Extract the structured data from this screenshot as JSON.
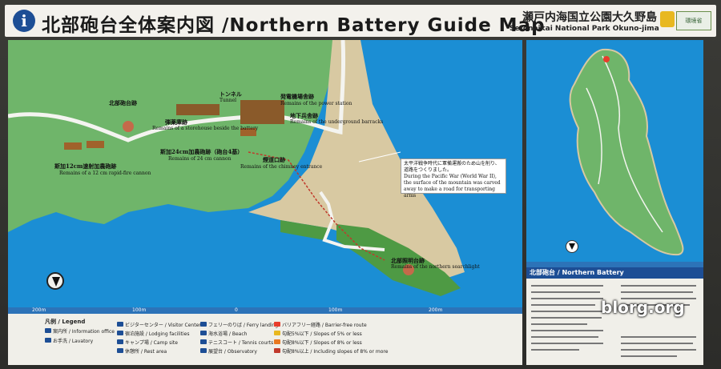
{
  "header": {
    "info_glyph": "i",
    "title": "北部砲台全体案内図 /Northern Battery Guide Map",
    "park_jp": "瀬戸内海国立公園大久野島",
    "park_en": "Setonaikai National Park Okuno-jima",
    "logo_text": "環境省"
  },
  "main_map": {
    "labels": {
      "tunnel": "トンネル",
      "tunnel_en": "Tunnel",
      "generator": "発電機場舎跡",
      "generator_en": "Remains of the power station",
      "north_battery": "北部砲台跡",
      "barracks": "地下兵舎跡",
      "barracks_en": "Remains of the underground barracks",
      "storehouse": "弾薬庫跡",
      "storehouse_en": "Remains of a storehouse beside the battery",
      "cannon": "斯加24cm加農砲跡（砲台4基）",
      "cannon_en": "Remains of 24 cm cannon",
      "rapid": "斯加12cm速射加農砲跡",
      "rapid_en": "Remains of a 12 cm rapid-fire cannon",
      "chimney": "煙道口跡",
      "chimney_en": "Remains of the chimney entrance",
      "searchlight": "北部照明台跡",
      "searchlight_en": "Remains of the northern searchlight"
    },
    "note_jp": "太平洋戦争時代に軍備運搬のため山を削り、道路をつくりました。",
    "note_en": "During the Pacific War (World War II), the surface of the mountain was carved away to make a road for transporting arms",
    "scale": [
      "200m",
      "100m",
      "0",
      "100m",
      "200m"
    ]
  },
  "legend": {
    "title": "凡例 / Legend",
    "items": [
      {
        "label": "案内所 / Information office",
        "color": "#1d4e95"
      },
      {
        "label": "お手洗 / Lavatory",
        "color": "#1d4e95"
      },
      {
        "label": "ビジターセンター / Visitor Center",
        "color": "#1d4e95"
      },
      {
        "label": "宿泊施設 / Lodging facilities",
        "color": "#1d4e95"
      },
      {
        "label": "キャンプ場 / Camp site",
        "color": "#1d4e95"
      },
      {
        "label": "休憩所 / Rest area",
        "color": "#1d4e95"
      },
      {
        "label": "フェリーのりば / Ferry landing",
        "color": "#1d4e95"
      },
      {
        "label": "海水浴場 / Beach",
        "color": "#1d4e95"
      },
      {
        "label": "テニスコート / Tennis courts",
        "color": "#1d4e95"
      },
      {
        "label": "展望台 / Observatory",
        "color": "#1d4e95"
      },
      {
        "label": "バリアフリー経路 / Barrier-free route",
        "color": "#e83d2c"
      },
      {
        "label": "勾配5%以下 / Slopes of 5% or less",
        "color": "#e8b820"
      },
      {
        "label": "勾配8%以下 / Slopes of 8% or less",
        "color": "#e87820"
      },
      {
        "label": "勾配8%以上 / Including slopes of 8% or more",
        "color": "#c0392b"
      }
    ]
  },
  "side_panel": {
    "heading": "北部砲台 / Northern Battery",
    "watermark": "blorg.org"
  }
}
